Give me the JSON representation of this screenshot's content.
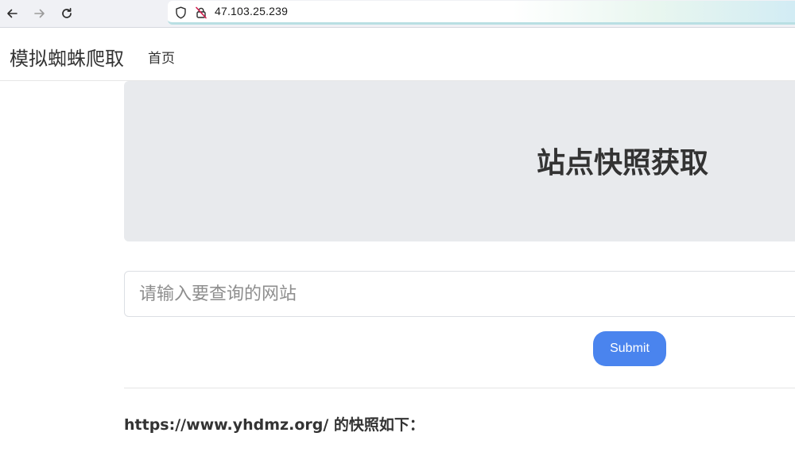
{
  "browser": {
    "back_icon": "arrow-left-icon",
    "forward_icon": "arrow-right-icon",
    "reload_icon": "reload-icon",
    "shield_icon": "shield-icon",
    "insecure_icon": "not-secure-lock-icon",
    "url": "47.103.25.239"
  },
  "navbar": {
    "brand": "模拟蜘蛛爬取",
    "links": [
      {
        "label": "首页"
      }
    ]
  },
  "jumbotron": {
    "title": "站点快照获取",
    "background": "#e8eaed"
  },
  "form": {
    "input_value": "",
    "input_placeholder": "请输入要查询的网站",
    "submit_label": "Submit",
    "submit_color": "#4a84ee"
  },
  "result": {
    "text": "https://www.yhdmz.org/ 的快照如下："
  }
}
